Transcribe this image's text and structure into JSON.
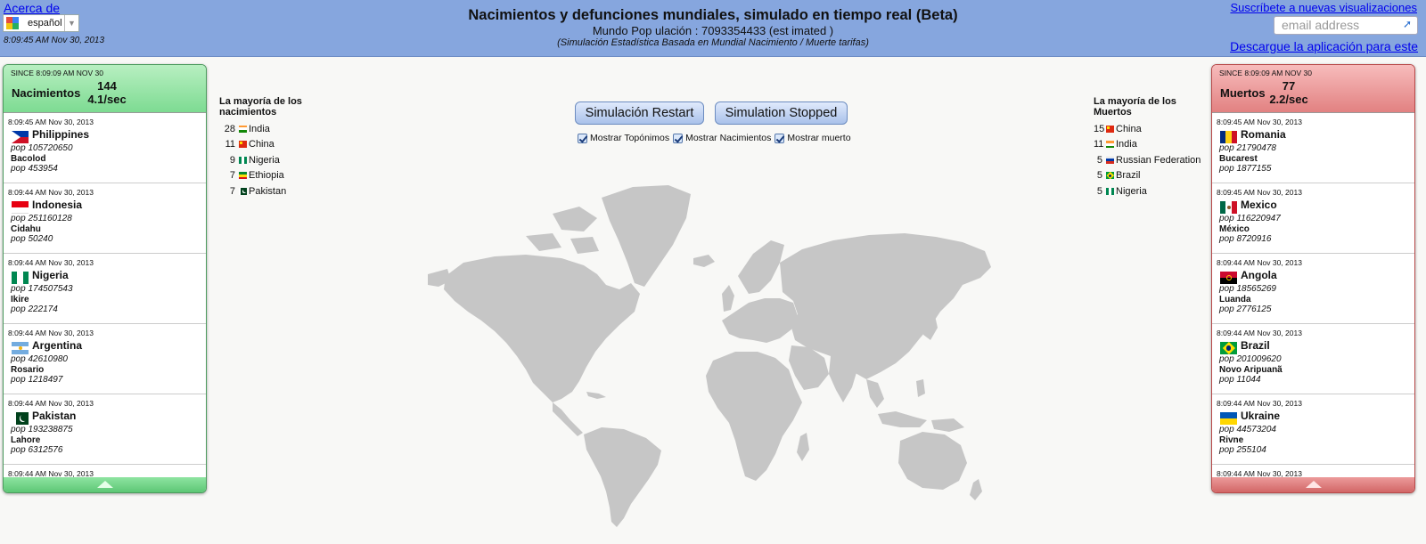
{
  "header": {
    "about_link": "Acerca de",
    "language": "español",
    "clock": "8:09:45 AM Nov 30, 2013",
    "title": "Nacimientos y defunciones mundiales, simulado en tiempo real (Beta)",
    "population_line": "Mundo Pop ulación : 7093354433 (est imated )",
    "subtitle": "(Simulación Estadística Basada en Mundial Nacimiento / Muerte tarifas)",
    "subscribe_link": "Suscríbete a nuevas visualizaciones",
    "email_placeholder": "email address",
    "download_link": "Descargue la aplicación para este"
  },
  "births_panel": {
    "since": "SINCE 8:09:09 AM NOV 30",
    "label": "Nacimientos",
    "count": "144",
    "rate": "4.1/sec",
    "events": [
      {
        "time": "8:09:45 AM Nov 30, 2013",
        "country": "Philippines",
        "flag": "philippines",
        "country_pop": "pop 105720650",
        "city": "Bacolod",
        "city_pop": "pop 453954"
      },
      {
        "time": "8:09:44 AM Nov 30, 2013",
        "country": "Indonesia",
        "flag": "indonesia",
        "country_pop": "pop 251160128",
        "city": "Cidahu",
        "city_pop": "pop 50240"
      },
      {
        "time": "8:09:44 AM Nov 30, 2013",
        "country": "Nigeria",
        "flag": "nigeria",
        "country_pop": "pop 174507543",
        "city": "Ikire",
        "city_pop": "pop 222174"
      },
      {
        "time": "8:09:44 AM Nov 30, 2013",
        "country": "Argentina",
        "flag": "argentina",
        "country_pop": "pop 42610980",
        "city": "Rosario",
        "city_pop": "pop 1218497"
      },
      {
        "time": "8:09:44 AM Nov 30, 2013",
        "country": "Pakistan",
        "flag": "pakistan",
        "country_pop": "pop 193238875",
        "city": "Lahore",
        "city_pop": "pop 6312576"
      }
    ],
    "partial_time": "8:09:44 AM Nov 30, 2013"
  },
  "deaths_panel": {
    "since": "SINCE 8:09:09 AM NOV 30",
    "label": "Muertos",
    "count": "77",
    "rate": "2.2/sec",
    "events": [
      {
        "time": "8:09:45 AM Nov 30, 2013",
        "country": "Romania",
        "flag": "romania",
        "country_pop": "pop 21790478",
        "city": "Bucarest",
        "city_pop": "pop 1877155"
      },
      {
        "time": "8:09:45 AM Nov 30, 2013",
        "country": "Mexico",
        "flag": "mexico",
        "country_pop": "pop 116220947",
        "city": "México",
        "city_pop": "pop 8720916"
      },
      {
        "time": "8:09:44 AM Nov 30, 2013",
        "country": "Angola",
        "flag": "angola",
        "country_pop": "pop 18565269",
        "city": "Luanda",
        "city_pop": "pop 2776125"
      },
      {
        "time": "8:09:44 AM Nov 30, 2013",
        "country": "Brazil",
        "flag": "brazil",
        "country_pop": "pop 201009620",
        "city": "Novo Aripuanã",
        "city_pop": "pop 11044"
      },
      {
        "time": "8:09:44 AM Nov 30, 2013",
        "country": "Ukraine",
        "flag": "ukraine",
        "country_pop": "pop 44573204",
        "city": "Rivne",
        "city_pop": "pop 255104"
      }
    ],
    "partial_time": "8:09:44 AM Nov 30, 2013"
  },
  "top_births": {
    "title_line1": "La mayoría de los",
    "title_line2": "nacimientos",
    "rows": [
      {
        "count": "28",
        "country": "India",
        "flag": "india"
      },
      {
        "count": "11",
        "country": "China",
        "flag": "china"
      },
      {
        "count": "9",
        "country": "Nigeria",
        "flag": "nigeria"
      },
      {
        "count": "7",
        "country": "Ethiopia",
        "flag": "ethiopia"
      },
      {
        "count": "7",
        "country": "Pakistan",
        "flag": "pakistan"
      }
    ]
  },
  "top_deaths": {
    "title_line1": "La mayoría de los",
    "title_line2": "Muertos",
    "rows": [
      {
        "count": "15",
        "country": "China",
        "flag": "china"
      },
      {
        "count": "11",
        "country": "India",
        "flag": "india"
      },
      {
        "count": "5",
        "country": "Russian Federation",
        "flag": "russia"
      },
      {
        "count": "5",
        "country": "Brazil",
        "flag": "brazil"
      },
      {
        "count": "5",
        "country": "Nigeria",
        "flag": "nigeria"
      }
    ]
  },
  "controls": {
    "restart_label": "Simulación Restart",
    "stopped_label": "Simulation Stopped",
    "check_toponyms": "Mostrar Topónimos",
    "check_births": "Mostrar Nacimientos",
    "check_deaths": "Mostrar muerto",
    "toponyms_checked": true,
    "births_checked": true,
    "deaths_checked": true
  },
  "colors": {
    "header_bg": "#86a6de",
    "births_green": "#7ddb92",
    "deaths_red": "#e28181",
    "map_land": "#c6c6c6"
  }
}
